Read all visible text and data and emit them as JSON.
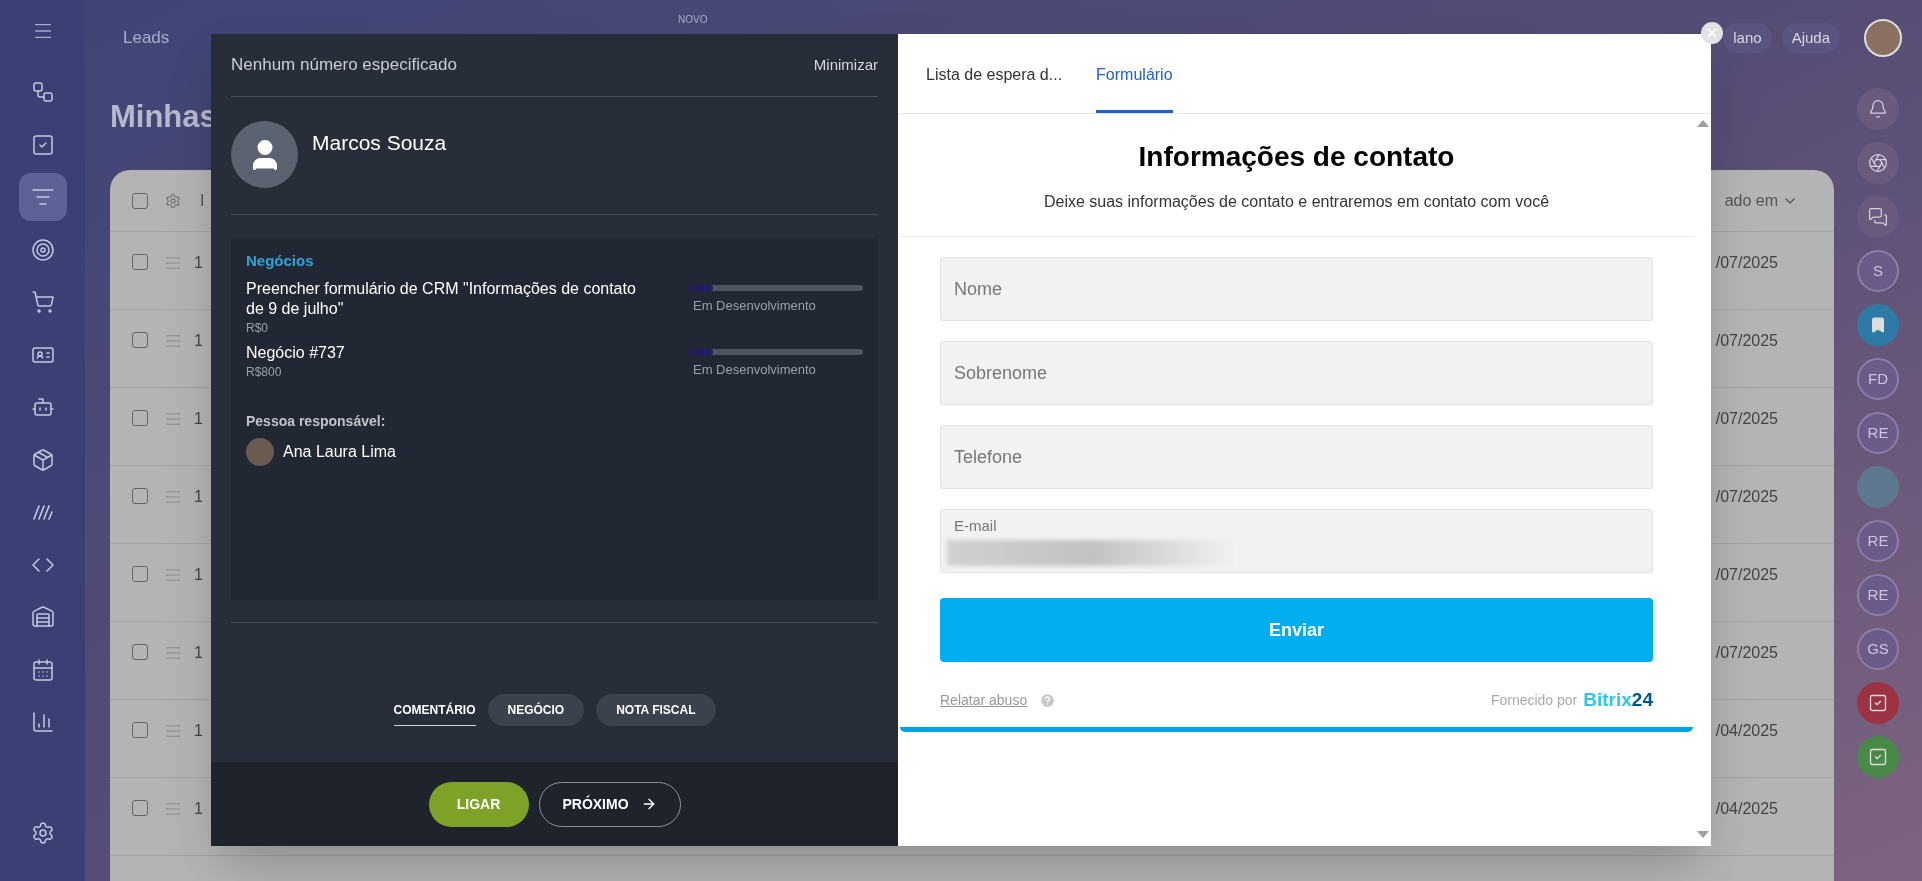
{
  "sidebar": {
    "items": [
      {
        "kind": "flow",
        "selected": false
      },
      {
        "kind": "tasks",
        "selected": false
      },
      {
        "kind": "funnel",
        "selected": true
      },
      {
        "kind": "target",
        "selected": false
      },
      {
        "kind": "cart",
        "selected": false
      },
      {
        "kind": "card",
        "selected": false
      },
      {
        "kind": "robot",
        "selected": false
      },
      {
        "kind": "package",
        "selected": false
      },
      {
        "kind": "stripes",
        "selected": false
      },
      {
        "kind": "code",
        "selected": false
      },
      {
        "kind": "warehouse",
        "selected": false
      },
      {
        "kind": "calendar",
        "selected": false
      },
      {
        "kind": "chart",
        "selected": false
      },
      {
        "kind": "settings",
        "selected": false
      }
    ]
  },
  "top_bar": {
    "nav": [
      {
        "label": "Leads"
      }
    ],
    "new_badge": "NOVO",
    "right": [
      {
        "label": "lano"
      },
      {
        "label": "Ajuda"
      }
    ]
  },
  "page": {
    "title": "Minhas"
  },
  "table": {
    "all_checked": false,
    "columns": [
      {
        "label": "I"
      },
      {
        "label": "ado em"
      }
    ],
    "rows": [
      {
        "id": "1",
        "date": "/07/2025",
        "checked": false
      },
      {
        "id": "1",
        "date": "/07/2025",
        "checked": false
      },
      {
        "id": "1",
        "date": "/07/2025",
        "checked": false
      },
      {
        "id": "1",
        "date": "/07/2025",
        "checked": false
      },
      {
        "id": "1",
        "date": "/07/2025",
        "checked": false
      },
      {
        "id": "1",
        "date": "/07/2025",
        "checked": false
      },
      {
        "id": "1",
        "date": "/04/2025",
        "checked": false
      },
      {
        "id": "1",
        "date": "/04/2025",
        "checked": false
      }
    ]
  },
  "right_rail": {
    "items": [
      {
        "kind": "bell"
      },
      {
        "kind": "spiral"
      },
      {
        "kind": "chat"
      },
      {
        "kind": "initials",
        "label": "S"
      },
      {
        "kind": "bookmark"
      },
      {
        "kind": "initials",
        "label": "FD"
      },
      {
        "kind": "initials",
        "label": "RE"
      },
      {
        "kind": "avatar"
      },
      {
        "kind": "initials",
        "label": "RE"
      },
      {
        "kind": "initials",
        "label": "RE"
      },
      {
        "kind": "initials",
        "label": "GS"
      },
      {
        "kind": "task",
        "color": "#9c3242"
      },
      {
        "kind": "task",
        "color": "#4a8a48"
      }
    ]
  },
  "call_panel": {
    "header": "Nenhum número especificado",
    "minimize": "Minimizar",
    "contact": {
      "name": "Marcos Souza"
    },
    "deals": {
      "title": "Negócios",
      "items": [
        {
          "title": "Preencher formulário de CRM \"Informações de contato de 9 de julho\"",
          "amount": "R$0",
          "stage": "Em Desenvolvimento",
          "level": 0.14
        },
        {
          "title": "Negócio #737",
          "amount": "R$800",
          "stage": "Em Desenvolvimento",
          "level": 0.14
        }
      ]
    },
    "responsible": {
      "label": "Pessoa responsável:",
      "name": "Ana Laura Lima"
    },
    "tabs": [
      {
        "label": "COMENTÁRIO",
        "selected": true
      },
      {
        "label": "NEGÓCIO",
        "selected": false
      },
      {
        "label": "NOTA FISCAL",
        "selected": false
      }
    ],
    "buttons": [
      {
        "kind": "call",
        "label": "LIGAR"
      },
      {
        "kind": "next",
        "label": "PRÓXIMO"
      }
    ]
  },
  "form_panel": {
    "tabs": [
      {
        "label": "Lista de espera d...",
        "selected": false
      },
      {
        "label": "Formulário",
        "selected": true
      }
    ],
    "title": "Informações de contato",
    "subtitle": "Deixe suas informações de contato e entraremos em contato com você",
    "fields": [
      {
        "kind": "empty",
        "placeholder": "Nome"
      },
      {
        "kind": "empty",
        "placeholder": "Sobrenome"
      },
      {
        "kind": "empty",
        "placeholder": "Telefone"
      },
      {
        "kind": "filled",
        "label": "E-mail"
      }
    ],
    "submit": "Enviar",
    "report": "Relatar abuso",
    "powered_by": "Fornecido por",
    "brand": "Bitrix",
    "brand_suffix": "24"
  }
}
